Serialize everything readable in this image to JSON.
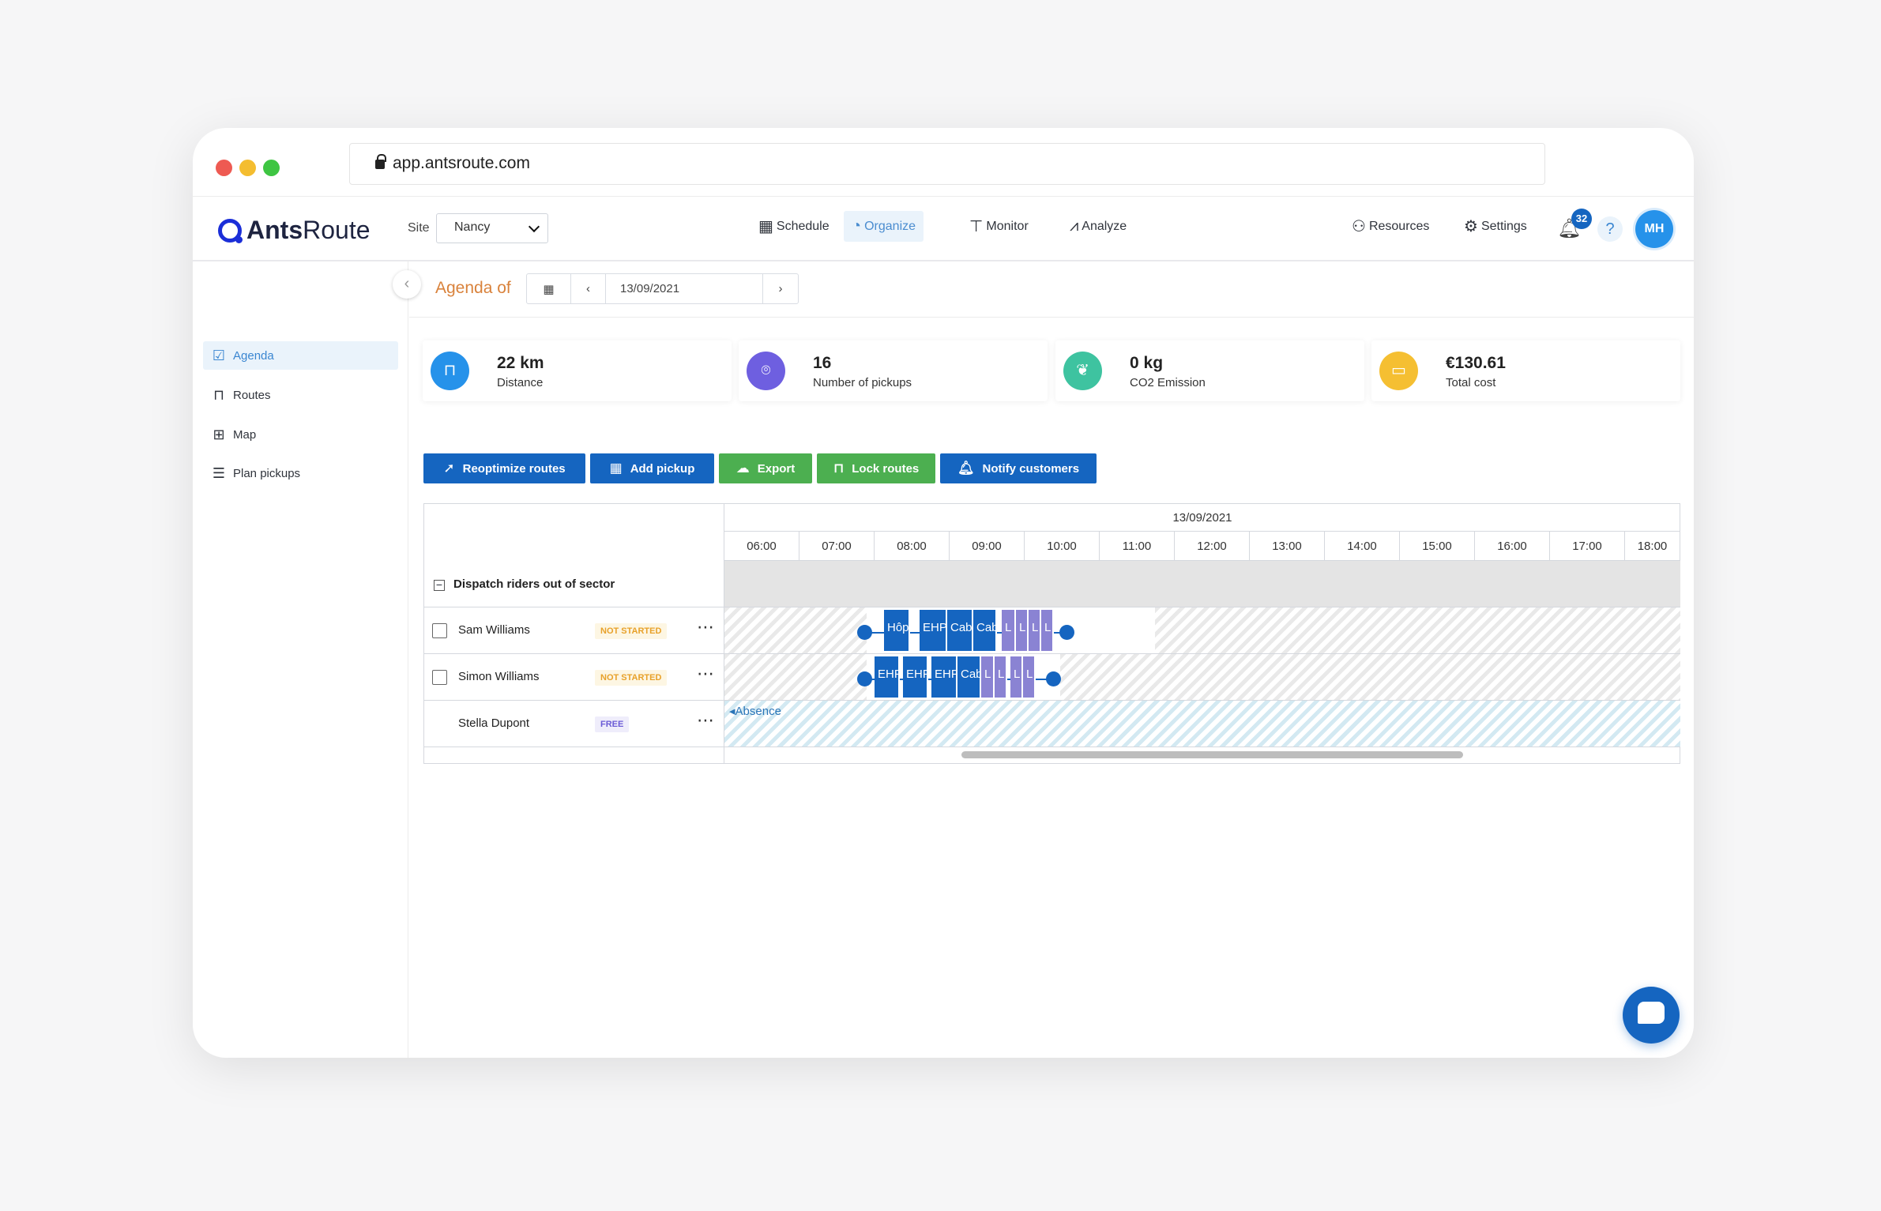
{
  "browser": {
    "url": "app.antsroute.com"
  },
  "brand": {
    "name_bold": "Ants",
    "name_light": "Route"
  },
  "site": {
    "label": "Site",
    "value": "Nancy"
  },
  "nav": {
    "schedule": "Schedule",
    "organize": "Organize",
    "monitor": "Monitor",
    "analyze": "Analyze",
    "resources": "Resources",
    "settings": "Settings",
    "notifications_count": "32",
    "help": "?",
    "avatar_initials": "MH"
  },
  "sidebar": {
    "items": [
      {
        "label": "Agenda",
        "icon": "calendar-check-icon"
      },
      {
        "label": "Routes",
        "icon": "map-book-icon"
      },
      {
        "label": "Map",
        "icon": "map-icon"
      },
      {
        "label": "Plan pickups",
        "icon": "checklist-icon"
      }
    ]
  },
  "agenda": {
    "title": "Agenda of",
    "date": "13/09/2021"
  },
  "kpis": [
    {
      "value": "22 km",
      "label": "Distance",
      "color": "#2692ea",
      "icon": "road-icon"
    },
    {
      "value": "16",
      "label": "Number of pickups",
      "color": "#6e5fe0",
      "icon": "pin-icon"
    },
    {
      "value": "0 kg",
      "label": "CO2 Emission",
      "color": "#3ec3a0",
      "icon": "leaf-icon"
    },
    {
      "value": "€130.61",
      "label": "Total cost",
      "color": "#f5bf32",
      "icon": "money-icon"
    }
  ],
  "actions": {
    "reoptimize": "Reoptimize routes",
    "add_pickup": "Add pickup",
    "export": "Export",
    "lock": "Lock routes",
    "notify": "Notify customers"
  },
  "gantt": {
    "date": "13/09/2021",
    "hours": [
      "06:00",
      "07:00",
      "08:00",
      "09:00",
      "10:00",
      "11:00",
      "12:00",
      "13:00",
      "14:00",
      "15:00",
      "16:00",
      "17:00",
      "18:00"
    ],
    "group": "Dispatch riders out of sector",
    "resources": [
      {
        "name": "Sam Williams",
        "status": "NOT STARTED"
      },
      {
        "name": "Simon Williams",
        "status": "NOT STARTED"
      },
      {
        "name": "Stella Dupont",
        "status": "FREE"
      }
    ],
    "sam_tasks": [
      "Hôp",
      "EHP",
      "Cab",
      "Cab",
      "L",
      "L",
      "L",
      "L"
    ],
    "simon_tasks": [
      "EHP",
      "EHP",
      "EHP",
      "Cab",
      "L",
      "L",
      "L",
      "L"
    ],
    "absence": "Absence"
  }
}
